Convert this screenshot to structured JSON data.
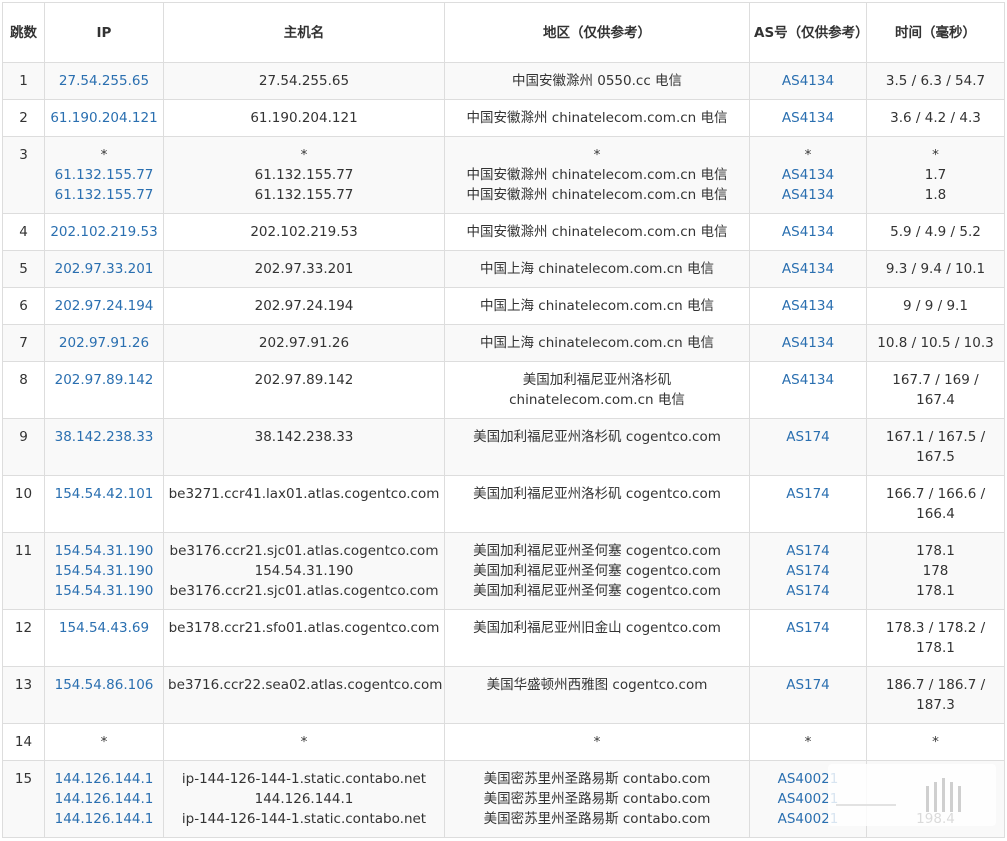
{
  "headers": {
    "hop": "跳数",
    "ip": "IP",
    "hostname": "主机名",
    "region": "地区（仅供参考）",
    "asn": "AS号（仅供参考）",
    "time": "时间（毫秒）"
  },
  "rows": [
    {
      "hop": "1",
      "ips": [
        "27.54.255.65"
      ],
      "hosts": [
        "27.54.255.65"
      ],
      "regions": [
        "中国安徽滁州 0550.cc 电信"
      ],
      "asns": [
        "AS4134"
      ],
      "times": [
        "3.5 / 6.3 / 54.7"
      ]
    },
    {
      "hop": "2",
      "ips": [
        "61.190.204.121"
      ],
      "hosts": [
        "61.190.204.121"
      ],
      "regions": [
        "中国安徽滁州 chinatelecom.com.cn 电信"
      ],
      "asns": [
        "AS4134"
      ],
      "times": [
        "3.6 / 4.2 / 4.3"
      ]
    },
    {
      "hop": "3",
      "ips": [
        "*",
        "61.132.155.77",
        "61.132.155.77"
      ],
      "hosts": [
        "*",
        "61.132.155.77",
        "61.132.155.77"
      ],
      "regions": [
        "*",
        "中国安徽滁州 chinatelecom.com.cn 电信",
        "中国安徽滁州 chinatelecom.com.cn 电信"
      ],
      "asns": [
        "*",
        "AS4134",
        "AS4134"
      ],
      "times": [
        "*",
        "1.7",
        "1.8"
      ]
    },
    {
      "hop": "4",
      "ips": [
        "202.102.219.53"
      ],
      "hosts": [
        "202.102.219.53"
      ],
      "regions": [
        "中国安徽滁州 chinatelecom.com.cn 电信"
      ],
      "asns": [
        "AS4134"
      ],
      "times": [
        "5.9 / 4.9 / 5.2"
      ]
    },
    {
      "hop": "5",
      "ips": [
        "202.97.33.201"
      ],
      "hosts": [
        "202.97.33.201"
      ],
      "regions": [
        "中国上海 chinatelecom.com.cn 电信"
      ],
      "asns": [
        "AS4134"
      ],
      "times": [
        "9.3 / 9.4 / 10.1"
      ]
    },
    {
      "hop": "6",
      "ips": [
        "202.97.24.194"
      ],
      "hosts": [
        "202.97.24.194"
      ],
      "regions": [
        "中国上海 chinatelecom.com.cn 电信"
      ],
      "asns": [
        "AS4134"
      ],
      "times": [
        "9 / 9 / 9.1"
      ]
    },
    {
      "hop": "7",
      "ips": [
        "202.97.91.26"
      ],
      "hosts": [
        "202.97.91.26"
      ],
      "regions": [
        "中国上海 chinatelecom.com.cn 电信"
      ],
      "asns": [
        "AS4134"
      ],
      "times": [
        "10.8 / 10.5 / 10.3"
      ]
    },
    {
      "hop": "8",
      "ips": [
        "202.97.89.142"
      ],
      "hosts": [
        "202.97.89.142"
      ],
      "regions": [
        "美国加利福尼亚州洛杉矶",
        "chinatelecom.com.cn 电信"
      ],
      "asns": [
        "AS4134"
      ],
      "times": [
        "167.7 / 169 /",
        "167.4"
      ]
    },
    {
      "hop": "9",
      "ips": [
        "38.142.238.33"
      ],
      "hosts": [
        "38.142.238.33"
      ],
      "regions": [
        "美国加利福尼亚州洛杉矶 cogentco.com"
      ],
      "asns": [
        "AS174"
      ],
      "times": [
        "167.1 / 167.5 /",
        "167.5"
      ]
    },
    {
      "hop": "10",
      "ips": [
        "154.54.42.101"
      ],
      "hosts": [
        "be3271.ccr41.lax01.atlas.cogentco.com"
      ],
      "regions": [
        "美国加利福尼亚州洛杉矶 cogentco.com"
      ],
      "asns": [
        "AS174"
      ],
      "times": [
        "166.7 / 166.6 /",
        "166.4"
      ]
    },
    {
      "hop": "11",
      "ips": [
        "154.54.31.190",
        "154.54.31.190",
        "154.54.31.190"
      ],
      "hosts": [
        "be3176.ccr21.sjc01.atlas.cogentco.com",
        "154.54.31.190",
        "be3176.ccr21.sjc01.atlas.cogentco.com"
      ],
      "regions": [
        "美国加利福尼亚州圣何塞 cogentco.com",
        "美国加利福尼亚州圣何塞 cogentco.com",
        "美国加利福尼亚州圣何塞 cogentco.com"
      ],
      "asns": [
        "AS174",
        "AS174",
        "AS174"
      ],
      "times": [
        "178.1",
        "178",
        "178.1"
      ]
    },
    {
      "hop": "12",
      "ips": [
        "154.54.43.69"
      ],
      "hosts": [
        "be3178.ccr21.sfo01.atlas.cogentco.com"
      ],
      "regions": [
        "美国加利福尼亚州旧金山 cogentco.com"
      ],
      "asns": [
        "AS174"
      ],
      "times": [
        "178.3 / 178.2 /",
        "178.1"
      ]
    },
    {
      "hop": "13",
      "ips": [
        "154.54.86.106"
      ],
      "hosts": [
        "be3716.ccr22.sea02.atlas.cogentco.com"
      ],
      "regions": [
        "美国华盛顿州西雅图 cogentco.com"
      ],
      "asns": [
        "AS174"
      ],
      "times": [
        "186.7 / 186.7 /",
        "187.3"
      ]
    },
    {
      "hop": "14",
      "ips": [
        "*"
      ],
      "hosts": [
        "*"
      ],
      "regions": [
        "*"
      ],
      "asns": [
        "*"
      ],
      "times": [
        "*"
      ]
    },
    {
      "hop": "15",
      "ips": [
        "144.126.144.1",
        "144.126.144.1",
        "144.126.144.1"
      ],
      "hosts": [
        "ip-144-126-144-1.static.contabo.net",
        "144.126.144.1",
        "ip-144-126-144-1.static.contabo.net"
      ],
      "regions": [
        "美国密苏里州圣路易斯 contabo.com",
        "美国密苏里州圣路易斯 contabo.com",
        "美国密苏里州圣路易斯 contabo.com"
      ],
      "asns": [
        "AS40021",
        "AS40021",
        "AS40021"
      ],
      "times": [
        "",
        "",
        "198.4"
      ]
    }
  ],
  "colors": {
    "link": "#2a6fb0",
    "border": "#dddddd",
    "stripe": "#f9f9f9"
  }
}
